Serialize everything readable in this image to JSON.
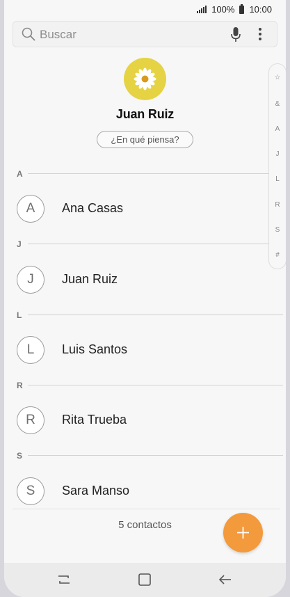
{
  "status_bar": {
    "battery": "100%",
    "time": "10:00"
  },
  "search": {
    "placeholder": "Buscar",
    "icons": [
      "search-icon",
      "microphone-icon",
      "more-options-icon"
    ]
  },
  "profile": {
    "name": "Juan Ruiz",
    "status_button": "¿En qué piensa?",
    "avatar": "daisy-flower"
  },
  "index_scroller": [
    "☆",
    "&",
    "A",
    "J",
    "L",
    "R",
    "S",
    "#"
  ],
  "sections": [
    {
      "letter": "A",
      "contacts": [
        {
          "initial": "A",
          "name": "Ana Casas"
        }
      ]
    },
    {
      "letter": "J",
      "contacts": [
        {
          "initial": "J",
          "name": "Juan Ruiz"
        }
      ]
    },
    {
      "letter": "L",
      "contacts": [
        {
          "initial": "L",
          "name": "Luis Santos"
        }
      ]
    },
    {
      "letter": "R",
      "contacts": [
        {
          "initial": "R",
          "name": "Rita Trueba"
        }
      ]
    },
    {
      "letter": "S",
      "contacts": [
        {
          "initial": "S",
          "name": "Sara Manso"
        }
      ]
    }
  ],
  "footer": {
    "count": "5 contactos",
    "add_icon": "plus-icon"
  },
  "nav_bar": [
    "recent-apps-icon",
    "home-icon",
    "back-icon"
  ],
  "colors": {
    "accent": "#f39a3d",
    "avatar_bg": "#e5d343"
  }
}
